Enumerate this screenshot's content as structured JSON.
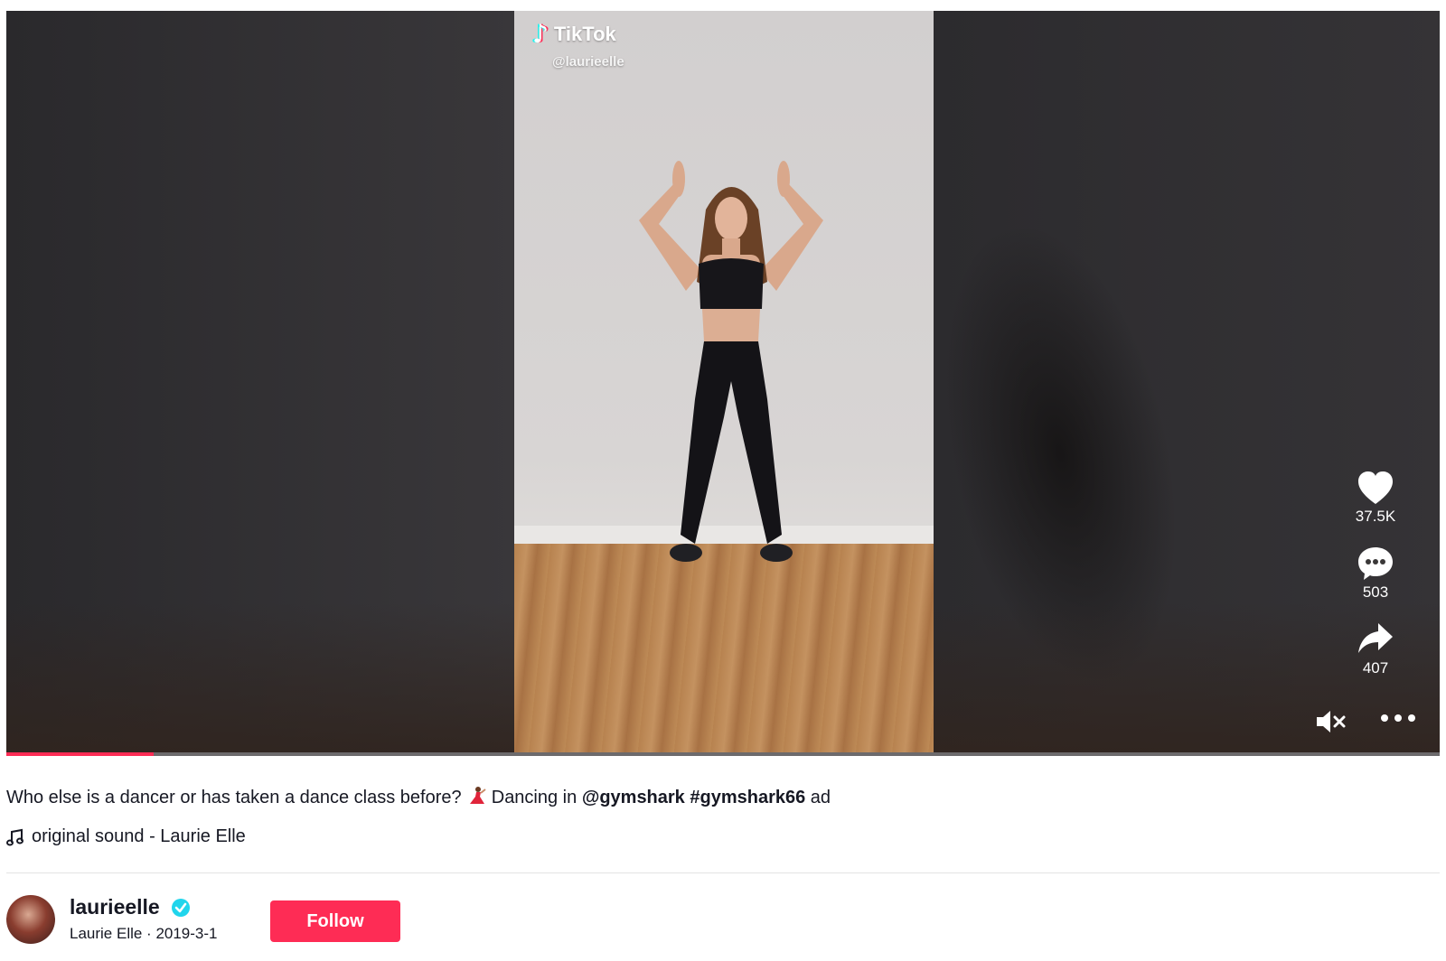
{
  "watermark": {
    "brand": "TikTok",
    "handle": "@laurieelle"
  },
  "actions": {
    "likes": "37.5K",
    "comments": "503",
    "shares": "407"
  },
  "progress": {
    "fraction": 0.103
  },
  "caption": {
    "text_before": "Who else is a dancer or has taken a dance class before? ",
    "emoji": "dancer-emoji",
    "text_middle": " Dancing in ",
    "mention": "@gymshark",
    "hashtag": "#gymshark66",
    "text_after": " ad"
  },
  "sound": {
    "label": "original sound - Laurie Elle"
  },
  "author": {
    "username": "laurieelle",
    "nickname": "Laurie Elle",
    "separator": " · ",
    "date": "2019-3-1"
  },
  "follow": {
    "label": "Follow"
  },
  "colors": {
    "accent": "#fe2c55",
    "verified": "#20d5ec"
  }
}
